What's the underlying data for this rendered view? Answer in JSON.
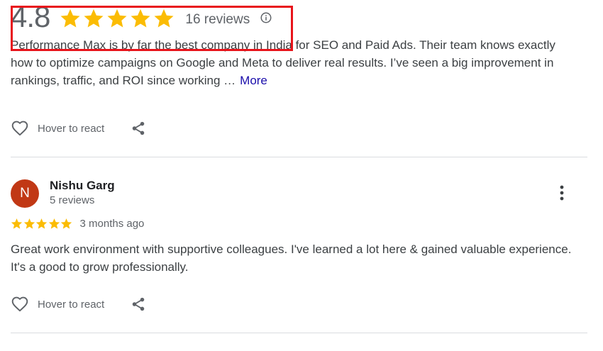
{
  "summary": {
    "rating": "4.8",
    "stars_filled": 5,
    "review_count": "16 reviews"
  },
  "reviews": [
    {
      "text_hidden_line": "Performance Max is by far the best company in India for SEO and Paid Ads. Their team knows exactly",
      "text": "how to optimize campaigns on Google and Meta to deliver real results. I’ve seen a big improvement in rankings, traffic, and ROI since working …",
      "more_label": "More",
      "react_label": "Hover to react"
    },
    {
      "avatar_letter": "N",
      "reviewer_name": "Nishu Garg",
      "reviewer_reviews": "5 reviews",
      "stars": 5,
      "date": "3 months ago",
      "text": "Great work environment with supportive colleagues. I've learned a lot here & gained valuable experience. It's a good to grow professionally.",
      "react_label": "Hover to react"
    }
  ],
  "colors": {
    "star": "#fbbc04",
    "avatar": "#c13815",
    "link": "#1a0dab",
    "highlight": "#e8141b"
  },
  "icons": [
    "star-icon",
    "info-icon",
    "heart-icon",
    "share-icon",
    "more-vert-icon"
  ]
}
